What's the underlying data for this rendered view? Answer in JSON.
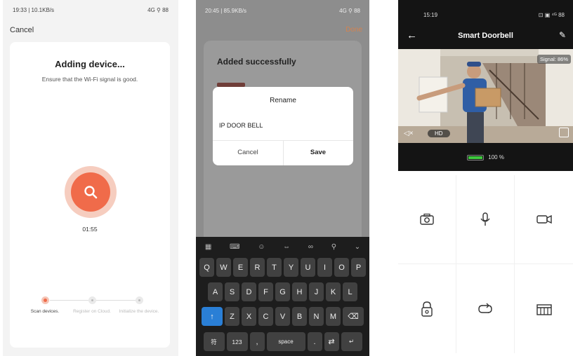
{
  "screen1": {
    "status_time": "19:33 | 10.1KB/s",
    "status_right": "4G ⚲ 88",
    "cancel_label": "Cancel",
    "title": "Adding device...",
    "subtitle": "Ensure that the Wi-Fi signal is good.",
    "timer": "01:55",
    "steps": [
      {
        "label": "Scan devices.",
        "active": true
      },
      {
        "label": "Register on Cloud.",
        "active": false
      },
      {
        "label": "Initialize the device.",
        "active": false
      }
    ],
    "colors": {
      "accent": "#f06b4a",
      "accent_light": "#f6cdbf"
    }
  },
  "screen2": {
    "status_time": "20:45 | 85.9KB/s",
    "status_right": "4G ⚲ 88",
    "done_label": "Done",
    "added_title": "Added successfully",
    "dialog": {
      "title": "Rename",
      "input_value": "IP DOOR BELL",
      "cancel_label": "Cancel",
      "save_label": "Save"
    },
    "keyboard": {
      "row1": [
        "Q",
        "W",
        "E",
        "R",
        "T",
        "Y",
        "U",
        "I",
        "O",
        "P"
      ],
      "row2": [
        "A",
        "S",
        "D",
        "F",
        "G",
        "H",
        "J",
        "K",
        "L"
      ],
      "row3": [
        "Z",
        "X",
        "C",
        "V",
        "B",
        "N",
        "M"
      ],
      "symbols_label": "符",
      "num_label": "123",
      "space_label": "space",
      "comma": ",",
      "period": "."
    }
  },
  "screen3": {
    "status_time": "15:19",
    "status_right": "⊡ ▣ ⁴ᴳ 88",
    "title": "Smart Doorbell",
    "signal": "Signal: 86%",
    "hd_label": "HD",
    "battery_text": "100 %",
    "battery_level": 1.0,
    "controls": [
      "camera-icon",
      "microphone-icon",
      "video-record-icon",
      "door-lock-icon",
      "refresh-icon",
      "gallery-icon"
    ]
  }
}
